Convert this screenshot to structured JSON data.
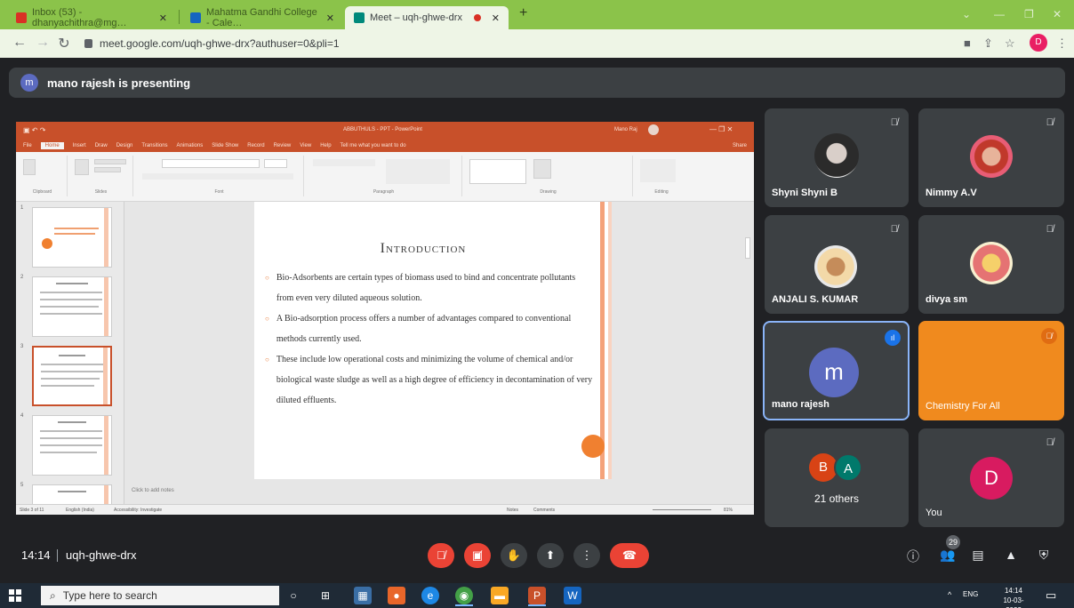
{
  "browser": {
    "tabs": [
      {
        "label": "Inbox (53) - dhanyachithra@mg…"
      },
      {
        "label": "Mahatma Gandhi College - Cale…"
      },
      {
        "label": "Meet – uqh-ghwe-drx"
      }
    ],
    "url": "meet.google.com/uqh-ghwe-drx?authuser=0&pli=1",
    "profile_initial": "D"
  },
  "meet": {
    "presenting_text": "mano rajesh is presenting",
    "presenter_initial": "m",
    "meeting_time": "14:14",
    "meeting_code": "uqh-ghwe-drx",
    "people_count": "29"
  },
  "ppt": {
    "title_bar": "ABBUTHULS - PPT - PowerPoint",
    "user": "Mano Raj",
    "tabs": [
      "File",
      "Home",
      "Insert",
      "Draw",
      "Design",
      "Transitions",
      "Animations",
      "Slide Show",
      "Record",
      "Review",
      "View",
      "Help",
      "Tell me what you want to do"
    ],
    "share": "Share",
    "groups": [
      "Clipboard",
      "Slides",
      "Font",
      "Paragraph",
      "Drawing",
      "Editing"
    ],
    "notes": "Click to add notes",
    "status_left": "Slide 3 of 11",
    "status_lang": "English (India)",
    "status_access": "Accessibility: Investigate",
    "status_notes": "Notes",
    "status_comments": "Comments",
    "zoom": "81%",
    "slide_numbers": [
      "1",
      "2",
      "3",
      "4",
      "5"
    ],
    "slide": {
      "title": "Introduction",
      "bullets": [
        "Bio-Adsorbents are certain types of biomass used to bind and concentrate pollutants from even very diluted aqueous solution.",
        "A Bio-adsorption process offers a number of advantages compared to conventional methods currently used.",
        "These include low operational costs and minimizing the volume of chemical and/or biological waste sludge as well as a high degree of efficiency in decontamination of very diluted effluents."
      ]
    }
  },
  "participants": [
    {
      "name": "Shyni Shyni B"
    },
    {
      "name": "Nimmy A.V"
    },
    {
      "name": "ANJALI S. KUMAR"
    },
    {
      "name": "divya sm"
    },
    {
      "name": "mano rajesh",
      "initial": "m"
    },
    {
      "name": "Chemistry For All"
    },
    {
      "name": "21 others",
      "initials": [
        "B",
        "A"
      ]
    },
    {
      "name": "You",
      "initial": "D"
    }
  ],
  "taskbar": {
    "search_placeholder": "Type here to search",
    "lang": "ENG",
    "time": "14:14",
    "date": "10-03-2022"
  },
  "colors": {
    "tab_bar": "#8bc34a",
    "meet_bg": "#202124",
    "tile_bg": "#3c4043",
    "ppt_accent": "#c8502a",
    "chemistry_tile": "#f08a1e",
    "end_call": "#ea4335",
    "presenter_avatar": "#5c6bc0"
  }
}
